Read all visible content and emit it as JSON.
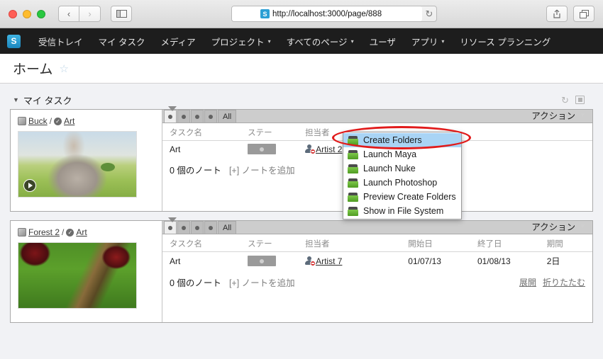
{
  "browser": {
    "back_label": "‹",
    "forward_label": "›",
    "sidebar_icon": "sidebar-icon",
    "url": "http://localhost:3000/page/888",
    "favicon_letter": "S",
    "reload_label": "↻",
    "share_icon": "share-icon",
    "tabs_icon": "tabs-icon"
  },
  "appnav": {
    "logo_letter": "S",
    "items": [
      {
        "label": "受信トレイ",
        "has_caret": false
      },
      {
        "label": "マイ タスク",
        "has_caret": false
      },
      {
        "label": "メディア",
        "has_caret": false
      },
      {
        "label": "プロジェクト",
        "has_caret": true
      },
      {
        "label": "すべてのページ",
        "has_caret": true
      },
      {
        "label": "ユーザ",
        "has_caret": false
      },
      {
        "label": "アプリ",
        "has_caret": true
      },
      {
        "label": "リソース プランニング",
        "has_caret": false
      }
    ]
  },
  "page": {
    "title": "ホーム",
    "star": "☆"
  },
  "section": {
    "collapse_triangle": "▼",
    "title": "マイ タスク",
    "refresh_icon": "refresh-icon",
    "layout_icon": "layout-icon"
  },
  "tabstrip": {
    "dot_tabs": [
      "●",
      "●",
      "●",
      "●"
    ],
    "all_label": "All",
    "action_label": "アクション",
    "action_caret": "▼"
  },
  "table": {
    "headers": {
      "name": "タスク名",
      "status": "ステー",
      "assignee": "担当者",
      "start": "開始日",
      "end": "終了日",
      "duration": "期間"
    }
  },
  "notes": {
    "count_label": "0 個のノート",
    "add_label": "[+] ノートを追加",
    "expand_label": "展開",
    "collapse_label": "折りたたむ"
  },
  "cards": [
    {
      "project": "Buck",
      "separator": "/",
      "task_link": "Art",
      "thumb_class": "buck",
      "has_play": true,
      "row": {
        "name": "Art",
        "assignee": "Artist 2",
        "start": "",
        "end": "",
        "duration": ""
      },
      "show_dates": false,
      "show_notes_links": false
    },
    {
      "project": "Forest 2",
      "separator": "/",
      "task_link": "Art",
      "thumb_class": "forest",
      "has_play": false,
      "row": {
        "name": "Art",
        "assignee": "Artist 7",
        "start": "01/07/13",
        "end": "01/08/13",
        "duration": "2日"
      },
      "show_dates": true,
      "show_notes_links": true
    }
  ],
  "popup_menu": {
    "items": [
      {
        "label": "Create Folders",
        "selected": true
      },
      {
        "label": "Launch Maya",
        "selected": false
      },
      {
        "label": "Launch Nuke",
        "selected": false
      },
      {
        "label": "Launch Photoshop",
        "selected": false
      },
      {
        "label": "Preview Create Folders",
        "selected": false
      },
      {
        "label": "Show in File System",
        "selected": false
      }
    ],
    "highlight_color": "#a9d4f5",
    "annotation_color": "#e11b1b"
  }
}
